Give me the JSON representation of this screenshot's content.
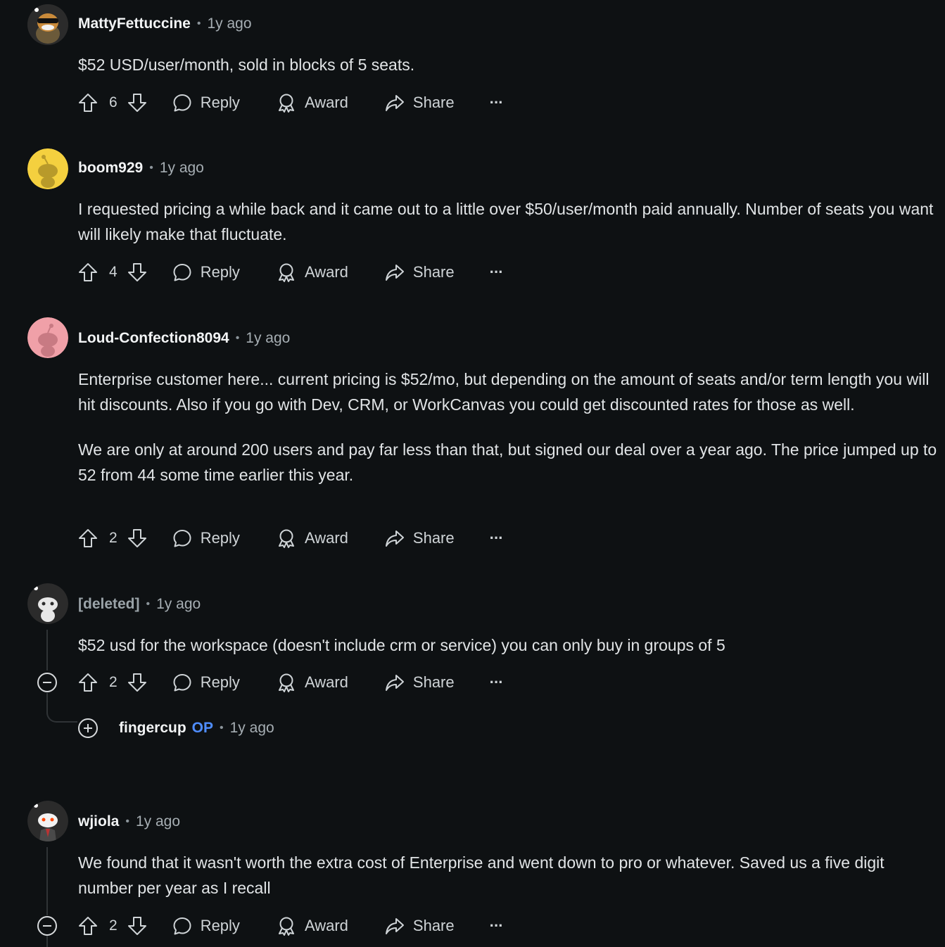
{
  "comments": [
    {
      "author": "MattyFettuccine",
      "time": "1y ago",
      "body": [
        "$52 USD/user/month, sold in blocks of 5 seats."
      ],
      "votes": "6",
      "reply": "Reply",
      "award": "Award",
      "share": "Share",
      "more": "···",
      "avatar_color": "#2b2b2b"
    },
    {
      "author": "boom929",
      "time": "1y ago",
      "body": [
        "I requested pricing a while back and it came out to a little over $50/user/month paid annually. Number of seats you want will likely make that fluctuate."
      ],
      "votes": "4",
      "reply": "Reply",
      "award": "Award",
      "share": "Share",
      "more": "···",
      "avatar_color": "#f4d03f"
    },
    {
      "author": "Loud-Confection8094",
      "time": "1y ago",
      "body": [
        "Enterprise customer here... current pricing is $52/mo, but depending on the amount of seats and/or term length you will hit discounts. Also if you go with Dev, CRM, or WorkCanvas you could get discounted rates for those as well.",
        "We are only at around 200 users and pay far less than that, but signed our deal over a year ago. The price jumped up to 52 from 44 some time earlier this year."
      ],
      "votes": "2",
      "reply": "Reply",
      "award": "Award",
      "share": "Share",
      "more": "···",
      "avatar_color": "#f0a0a8"
    },
    {
      "author": "[deleted]",
      "time": "1y ago",
      "body": [
        "$52 usd for the workspace (doesn't include crm or service) you can only buy in groups of 5"
      ],
      "votes": "2",
      "reply": "Reply",
      "award": "Award",
      "share": "Share",
      "more": "···",
      "avatar_color": "#2b2b2b",
      "collapsed_reply": {
        "author": "fingercup",
        "badge": "OP",
        "time": "1y ago"
      }
    },
    {
      "author": "wjiola",
      "time": "1y ago",
      "body": [
        "We found that it wasn't worth the extra cost of Enterprise and went down to pro or whatever. Saved us a five digit number per year as I recall"
      ],
      "votes": "2",
      "reply": "Reply",
      "award": "Award",
      "share": "Share",
      "more": "···",
      "avatar_color": "#2b2b2b"
    }
  ],
  "dot": "•"
}
